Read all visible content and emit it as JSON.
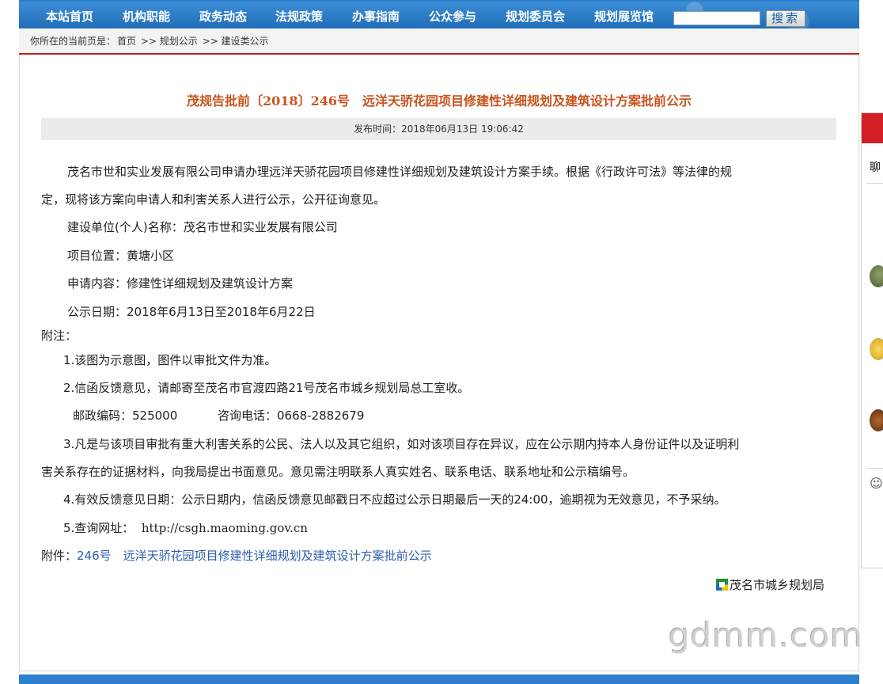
{
  "nav": {
    "items": [
      {
        "label": "本站首页"
      },
      {
        "label": "机构职能"
      },
      {
        "label": "政务动态"
      },
      {
        "label": "法规政策"
      },
      {
        "label": "办事指南"
      },
      {
        "label": "公众参与"
      },
      {
        "label": "规划委员会"
      },
      {
        "label": "规划展览馆"
      }
    ],
    "search_value": "",
    "search_button": "搜索"
  },
  "breadcrumb": {
    "prefix": "你所在的当前页是：",
    "items": [
      "首页",
      ">> 规划公示",
      ">> 建设类公示"
    ]
  },
  "article": {
    "title": "茂规告批前〔2018〕246号　远洋天骄花园项目修建性详细规划及建筑设计方案批前公示",
    "publish_time": "发布时间：2018年06月13日  19:06:42",
    "para1_line1": "茂名市世和实业发展有限公司申请办理远洋天骄花园项目修建性详细规划及建筑设计方案手续。根据《行政许可法》等法律的规",
    "para1_line2": "定，现将该方案向申请人和利害关系人进行公示，公开征询意见。",
    "unit": "建设单位(个人)名称：茂名市世和实业发展有限公司",
    "location": "项目位置：黄塘小区",
    "content": "申请内容：修建性详细规划及建筑设计方案",
    "period": "公示日期：2018年6月13日至2018年6月22日",
    "notes_label": "附注：",
    "note1": "1.该图为示意图，图件以审批文件为准。",
    "note2": "2.信函反馈意见，请邮寄至茂名市官渡四路21号茂名市城乡规划局总工室收。",
    "postcode": "邮政编码：525000",
    "phone": "咨询电话：0668-2882679",
    "note3_line1": "3.凡是与该项目审批有重大利害关系的公民、法人以及其它组织，如对该项目存在异议，应在公示期内持本人身份证件以及证明利",
    "note3_line2": "害关系存在的证据材料，向我局提出书面意见。意见需注明联系人真实姓名、联系电话、联系地址和公示稿编号。",
    "note4": "4.有效反馈意见日期：公示日期内，信函反馈意见邮戳日不应超过公示日期最后一天的24:00，逾期视为无效意见，不予采纳。",
    "note5_label": "5.查询网址：",
    "note5_url": "http://csgh.maoming.gov.cn",
    "attachment_label": "附件：",
    "attachment_link": "246号　远洋天骄花园项目修建性详细规划及建筑设计方案批前公示",
    "signature": "茂名市城乡规划局"
  },
  "watermark": "gdmm.com",
  "side_widget": {
    "label": "聊"
  },
  "colors": {
    "nav_bg": "#1f6db8",
    "title": "#c8541d",
    "link": "#2a5fae",
    "breadcrumb_border": "#c41a1a"
  }
}
